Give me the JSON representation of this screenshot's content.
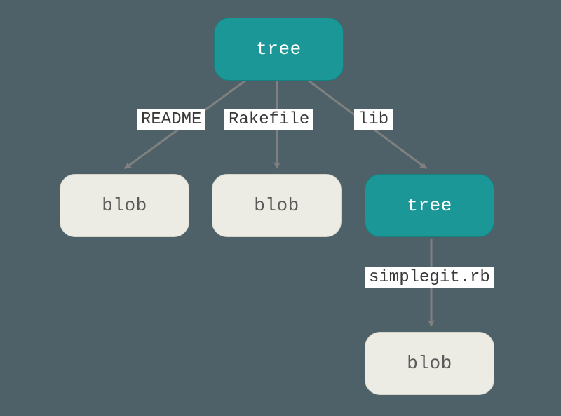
{
  "diagram": {
    "nodes": {
      "root_tree": {
        "type": "tree",
        "label": "tree"
      },
      "blob_readme": {
        "type": "blob",
        "label": "blob"
      },
      "blob_rakefile": {
        "type": "blob",
        "label": "blob"
      },
      "lib_tree": {
        "type": "tree",
        "label": "tree"
      },
      "blob_simplegit": {
        "type": "blob",
        "label": "blob"
      }
    },
    "edges": {
      "readme": {
        "from": "root_tree",
        "to": "blob_readme",
        "label": "README"
      },
      "rakefile": {
        "from": "root_tree",
        "to": "blob_rakefile",
        "label": "Rakefile"
      },
      "lib": {
        "from": "root_tree",
        "to": "lib_tree",
        "label": "lib"
      },
      "simplegit": {
        "from": "lib_tree",
        "to": "blob_simplegit",
        "label": "simplegit.rb"
      }
    }
  },
  "colors": {
    "background": "#4e6168",
    "tree_fill": "#1b9797",
    "tree_text": "#ffffff",
    "blob_fill": "#edece4",
    "blob_text": "#5a5a58",
    "label_bg": "#ffffff",
    "arrow": "#808080"
  }
}
